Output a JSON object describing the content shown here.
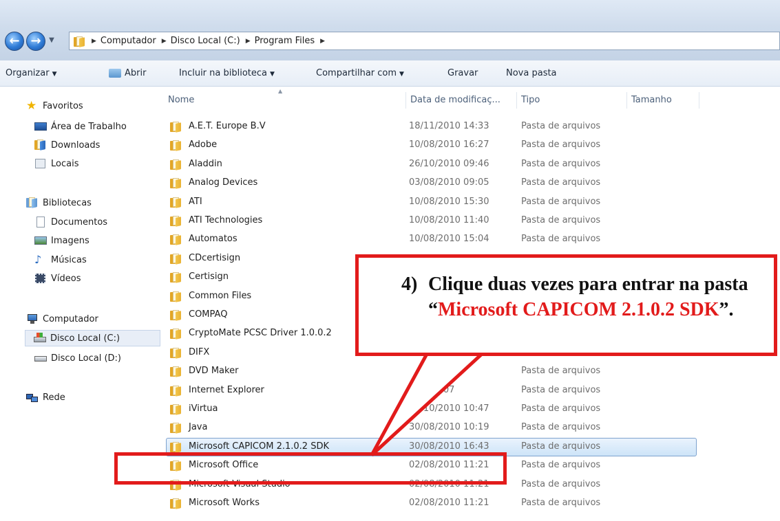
{
  "address_bar": {
    "breadcrumbs": [
      "Computador",
      "Disco Local (C:)",
      "Program Files"
    ]
  },
  "toolbar": {
    "organize": "Organizar",
    "open": "Abrir",
    "include_library": "Incluir na biblioteca",
    "share_with": "Compartilhar com",
    "burn": "Gravar",
    "new_folder": "Nova pasta"
  },
  "navigation": {
    "favorites": {
      "label": "Favoritos",
      "items": [
        "Área de Trabalho",
        "Downloads",
        "Locais"
      ]
    },
    "libraries": {
      "label": "Bibliotecas",
      "items": [
        "Documentos",
        "Imagens",
        "Músicas",
        "Vídeos"
      ]
    },
    "computer": {
      "label": "Computador",
      "items": [
        "Disco Local (C:)",
        "Disco Local (D:)"
      ]
    },
    "network": {
      "label": "Rede"
    }
  },
  "file_list": {
    "columns": {
      "name": "Nome",
      "date": "Data de modificaç...",
      "type": "Tipo",
      "size": "Tamanho"
    },
    "rows": [
      {
        "name": "A.E.T. Europe B.V",
        "date": "18/11/2010 14:33",
        "type": "Pasta de arquivos"
      },
      {
        "name": "Adobe",
        "date": "10/08/2010 16:27",
        "type": "Pasta de arquivos"
      },
      {
        "name": "Aladdin",
        "date": "26/10/2010 09:46",
        "type": "Pasta de arquivos"
      },
      {
        "name": "Analog Devices",
        "date": "03/08/2010 09:05",
        "type": "Pasta de arquivos"
      },
      {
        "name": "ATI",
        "date": "10/08/2010 15:30",
        "type": "Pasta de arquivos"
      },
      {
        "name": "ATI Technologies",
        "date": "10/08/2010 11:40",
        "type": "Pasta de arquivos"
      },
      {
        "name": "Automatos",
        "date": "10/08/2010 15:04",
        "type": "Pasta de arquivos"
      },
      {
        "name": "CDcertisign",
        "date": "",
        "type": ""
      },
      {
        "name": "Certisign",
        "date": "",
        "type": ""
      },
      {
        "name": "Common Files",
        "date": "",
        "type": ""
      },
      {
        "name": "COMPAQ",
        "date": "",
        "type": ""
      },
      {
        "name": "CryptoMate PCSC Driver 1.0.0.2",
        "date": "",
        "type": ""
      },
      {
        "name": "DIFX",
        "date": "",
        "type": ""
      },
      {
        "name": "DVD Maker",
        "date": "",
        "type": "Pasta de arquivos"
      },
      {
        "name": "Internet Explorer",
        "date": "010 14:07",
        "type": "Pasta de arquivos"
      },
      {
        "name": "iVirtua",
        "date": "08/10/2010 10:47",
        "type": "Pasta de arquivos"
      },
      {
        "name": "Java",
        "date": "30/08/2010 10:19",
        "type": "Pasta de arquivos"
      },
      {
        "name": "Microsoft CAPICOM 2.1.0.2 SDK",
        "date": "30/08/2010 16:43",
        "type": "Pasta de arquivos"
      },
      {
        "name": "Microsoft Office",
        "date": "02/08/2010 11:21",
        "type": "Pasta de arquivos"
      },
      {
        "name": "Microsoft Visual Studio",
        "date": "02/08/2010 11:21",
        "type": "Pasta de arquivos"
      },
      {
        "name": "Microsoft Works",
        "date": "02/08/2010 11:21",
        "type": "Pasta de arquivos"
      }
    ]
  },
  "annotation": {
    "step": "4)",
    "text_before": "Clique duas vezes para entrar na pasta “",
    "highlight": "Microsoft CAPICOM 2.1.0.2 SDK",
    "text_after": "”."
  },
  "colors": {
    "annotation_red": "#e21b1b",
    "selection_border": "#7da2ce"
  }
}
